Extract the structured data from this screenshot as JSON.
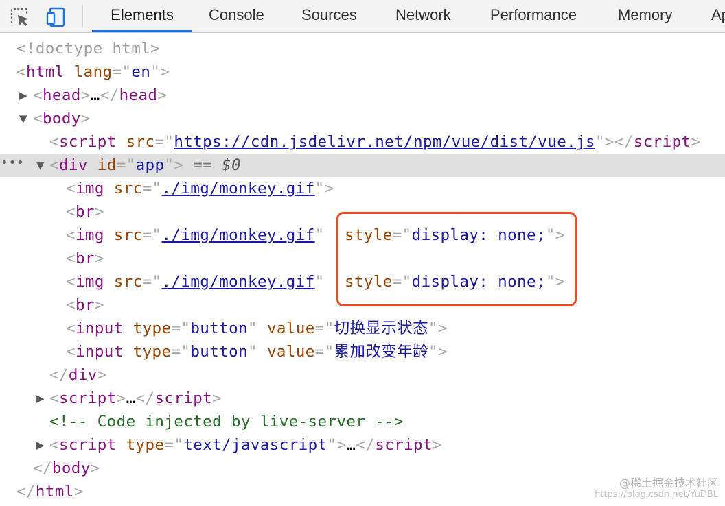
{
  "toolbar": {
    "inspect_icon": "element-picker-icon",
    "device_icon": "device-toggle-icon",
    "accent_color": "#1a73e8",
    "tabs": [
      {
        "label": "Elements",
        "active": true
      },
      {
        "label": "Console"
      },
      {
        "label": "Sources"
      },
      {
        "label": "Network"
      },
      {
        "label": "Performance"
      },
      {
        "label": "Memory"
      },
      {
        "label": "Ap"
      }
    ]
  },
  "dom": {
    "doctype": "<!doctype html>",
    "html_open": {
      "tag": "html",
      "attr": "lang",
      "value": "en"
    },
    "head": {
      "tag": "head",
      "ellipsis": "…"
    },
    "body_tag": "body",
    "script_vue": {
      "tag": "script",
      "attr": "src",
      "value": "https://cdn.jsdelivr.net/npm/vue/dist/vue.js"
    },
    "div_app": {
      "tag": "div",
      "attr": "id",
      "value": "app",
      "eq": "==",
      "ref": "$0"
    },
    "br_tag": "br",
    "img": {
      "tag": "img",
      "attr": "src",
      "value": "./img/monkey.gif"
    },
    "style_attr": {
      "attr": "style",
      "value": "display: none;"
    },
    "input_tag": "input",
    "type_attr": "type",
    "type_value": "button",
    "value_attr": "value",
    "btn_toggle_value": "切换显示状态",
    "btn_age_value": "累加改变年龄",
    "script_collapsed": {
      "tag": "script",
      "ellipsis": "…"
    },
    "comment": "<!-- Code injected by live-server -->",
    "script_js": {
      "tag": "script",
      "attr": "type",
      "value": "text/javascript",
      "ellipsis": "…"
    },
    "highlight_color": "#ee4a2a"
  },
  "watermark": {
    "line1": "@稀土掘金技术社区",
    "line2": "https://blog.csdn.net/YuDBL"
  }
}
